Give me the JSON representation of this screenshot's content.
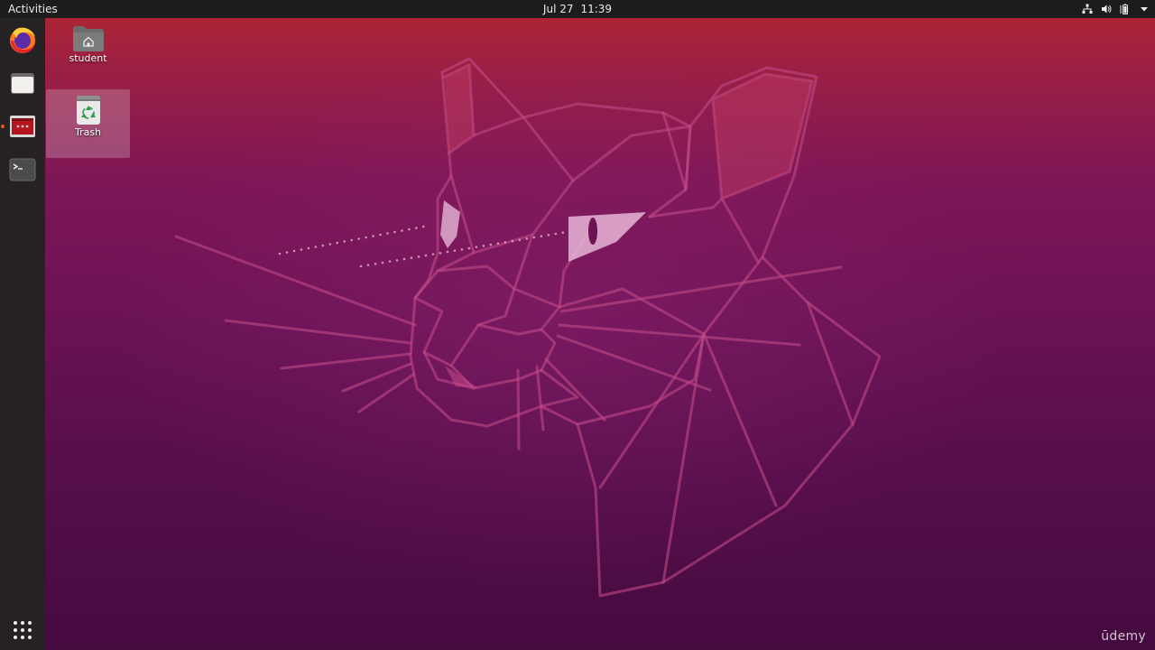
{
  "topbar": {
    "activities_label": "Activities",
    "date": "Jul 27",
    "time": "11:39",
    "tray": [
      "network-icon",
      "volume-icon",
      "battery-icon",
      "system-menu-chevron-icon"
    ]
  },
  "dock": {
    "items": [
      {
        "name": "firefox",
        "icon": "firefox-icon",
        "running": false
      },
      {
        "name": "files",
        "icon": "files-icon",
        "running": false
      },
      {
        "name": "remote-desktop",
        "icon": "remote-desktop-icon",
        "running": true
      },
      {
        "name": "terminal",
        "icon": "terminal-icon",
        "running": false
      }
    ],
    "show_apps_icon": "grid-icon"
  },
  "desktop": {
    "icons": [
      {
        "label": "student",
        "icon": "home-folder-icon"
      },
      {
        "label": "Trash",
        "icon": "trash-icon",
        "selected": true
      }
    ]
  },
  "watermark": "ūdemy",
  "colors": {
    "topbar": "#1c1c1c",
    "dock": "#262223",
    "accent": "#e95420",
    "wallpaper_top": "#b1262f",
    "wallpaper_bottom": "#450a3f"
  }
}
